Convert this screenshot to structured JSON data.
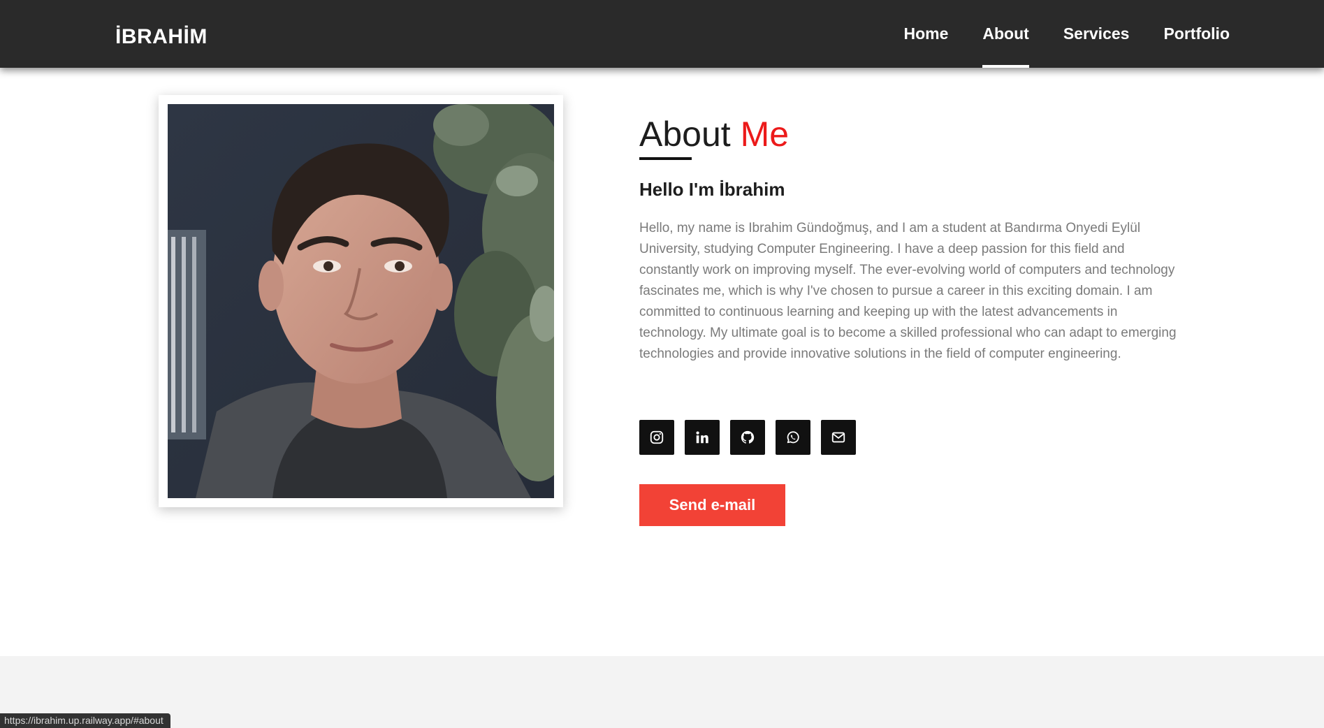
{
  "header": {
    "brand": "İBRAHİM",
    "nav": [
      {
        "label": "Home",
        "active": false
      },
      {
        "label": "About",
        "active": true
      },
      {
        "label": "Services",
        "active": false
      },
      {
        "label": "Portfolio",
        "active": false
      }
    ]
  },
  "about": {
    "title_main": "About",
    "title_accent": "Me",
    "greeting": "Hello I'm İbrahim",
    "bio": "Hello, my name is Ibrahim Gündoğmuş, and I am a student at Bandırma Onyedi Eylül University, studying Computer Engineering. I have a deep passion for this field and constantly work on improving myself. The ever-evolving world of computers and technology fascinates me, which is why I've chosen to pursue a career in this exciting domain. I am committed to continuous learning and keeping up with the latest advancements in technology. My ultimate goal is to become a skilled professional who can adapt to emerging technologies and provide innovative solutions in the field of computer engineering.",
    "photo_icon": "portrait-photo",
    "social": [
      {
        "name": "instagram-icon"
      },
      {
        "name": "linkedin-icon"
      },
      {
        "name": "github-icon"
      },
      {
        "name": "whatsapp-icon"
      },
      {
        "name": "email-icon"
      }
    ],
    "send_button": "Send e-mail"
  },
  "status_bar": {
    "url": "https://ibrahim.up.railway.app/#about"
  },
  "colors": {
    "header_bg": "#2a2a2a",
    "accent_red": "#ec1a1a",
    "button_red": "#f24236",
    "social_bg": "#111111",
    "body_text": "#7a7a7a"
  }
}
